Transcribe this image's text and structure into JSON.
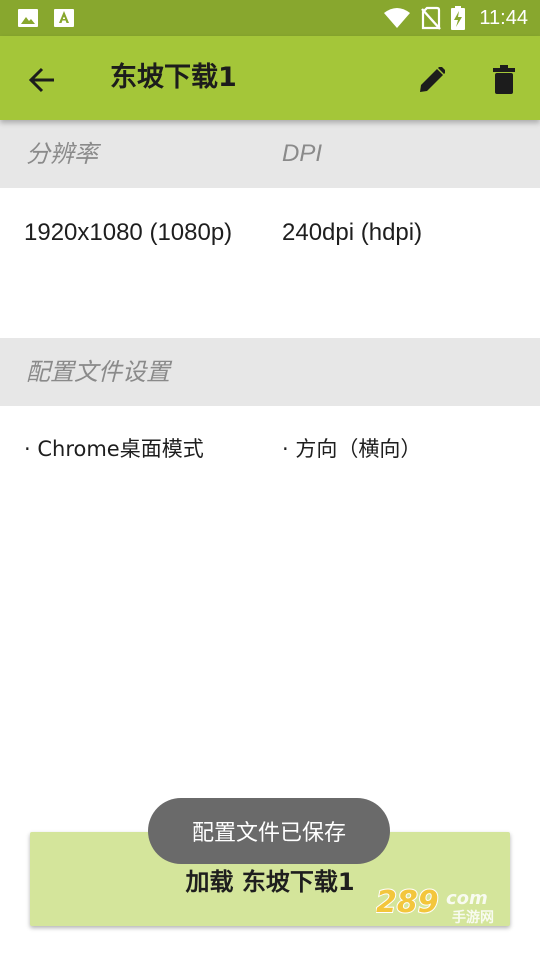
{
  "status_bar": {
    "time": "11:44",
    "icons": [
      "image-icon",
      "font-icon",
      "wifi-icon",
      "no-sim-icon",
      "battery-charging-icon"
    ]
  },
  "app_bar": {
    "title": "东坡下载1",
    "back_icon": "arrow-back-icon",
    "edit_icon": "pencil-icon",
    "delete_icon": "trash-icon",
    "color": "#a4c639"
  },
  "display_section": {
    "resolution_header": "分辨率",
    "dpi_header": "DPI",
    "resolution_value": "1920x1080 (1080p)",
    "dpi_value": "240dpi (hdpi)"
  },
  "profile_section": {
    "header": "配置文件设置",
    "features": [
      "· Chrome桌面模式",
      "· 方向（横向）"
    ]
  },
  "load_button": {
    "label": "加载 东坡下载1",
    "color": "#d4e59b"
  },
  "toast": {
    "message": "配置文件已保存"
  },
  "watermark": {
    "number": "289",
    "suffix": "com",
    "subtitle": "手游网"
  }
}
